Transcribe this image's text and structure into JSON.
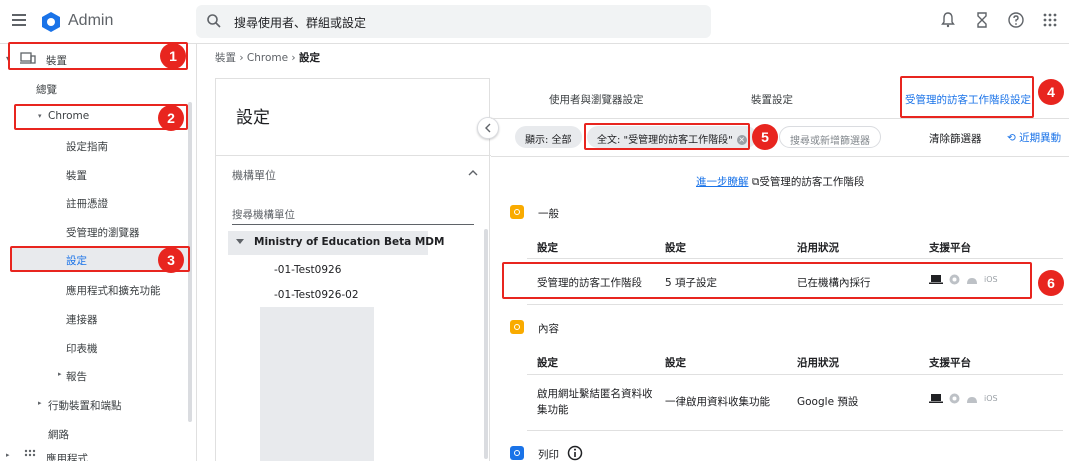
{
  "app": {
    "title": "Admin"
  },
  "search": {
    "text": "搜尋使用者、群組或設定"
  },
  "sidebar": {
    "items": [
      {
        "label": "裝置"
      },
      {
        "label": "總覽"
      },
      {
        "label": "Chrome"
      },
      {
        "label": "設定指南"
      },
      {
        "label": "裝置"
      },
      {
        "label": "註冊憑證"
      },
      {
        "label": "受管理的瀏覽器"
      },
      {
        "label": "設定"
      },
      {
        "label": "應用程式和擴充功能"
      },
      {
        "label": "連接器"
      },
      {
        "label": "印表機"
      },
      {
        "label": "報告"
      },
      {
        "label": "行動裝置和端點"
      },
      {
        "label": "網路"
      },
      {
        "label": "應用程式"
      }
    ]
  },
  "breadcrumb": {
    "part1": "裝置",
    "sep": "›",
    "part2": "Chrome",
    "current": "設定"
  },
  "middle": {
    "title": "設定",
    "ou_title": "機構單位",
    "ou_search": "搜尋機構單位",
    "ou_root": "Ministry of Education Beta MDM",
    "ou_children": [
      "-01-Test0926",
      "-01-Test0926-02"
    ]
  },
  "tabs": [
    "使用者與瀏覽器設定",
    "裝置設定",
    "受管理的訪客工作階段設定"
  ],
  "filters": {
    "show_all": "顯示: 全部",
    "fulltext": "全文: \"受管理的訪客工作階段\"",
    "add_placeholder": "搜尋或新增篩選器",
    "clear": "清除篩選器",
    "recent": "近期異動"
  },
  "learn": {
    "link": "進一步瞭解",
    "text": "受管理的訪客工作階段"
  },
  "sections": [
    {
      "title": "一般",
      "headers": [
        "設定",
        "設定",
        "沿用狀況",
        "支援平台"
      ],
      "rows": [
        {
          "name": "受管理的訪客工作階段",
          "value": "5 項子設定",
          "status": "已在機構內採行"
        }
      ]
    },
    {
      "title": "內容",
      "headers": [
        "設定",
        "設定",
        "沿用狀況",
        "支援平台"
      ],
      "rows": [
        {
          "name_line1": "啟用網址繫結匿名資料收",
          "name_line2": "集功能",
          "value": "一律啟用資料收集功能",
          "status": "Google 預設"
        }
      ]
    },
    {
      "title": "列印"
    }
  ],
  "platform_ios": "iOS",
  "annotations": [
    "1",
    "2",
    "3",
    "4",
    "5",
    "6"
  ],
  "colors": {
    "accent": "#1a73e8",
    "highlight": "#e8251f",
    "section_yellow": "#f9ab00"
  }
}
